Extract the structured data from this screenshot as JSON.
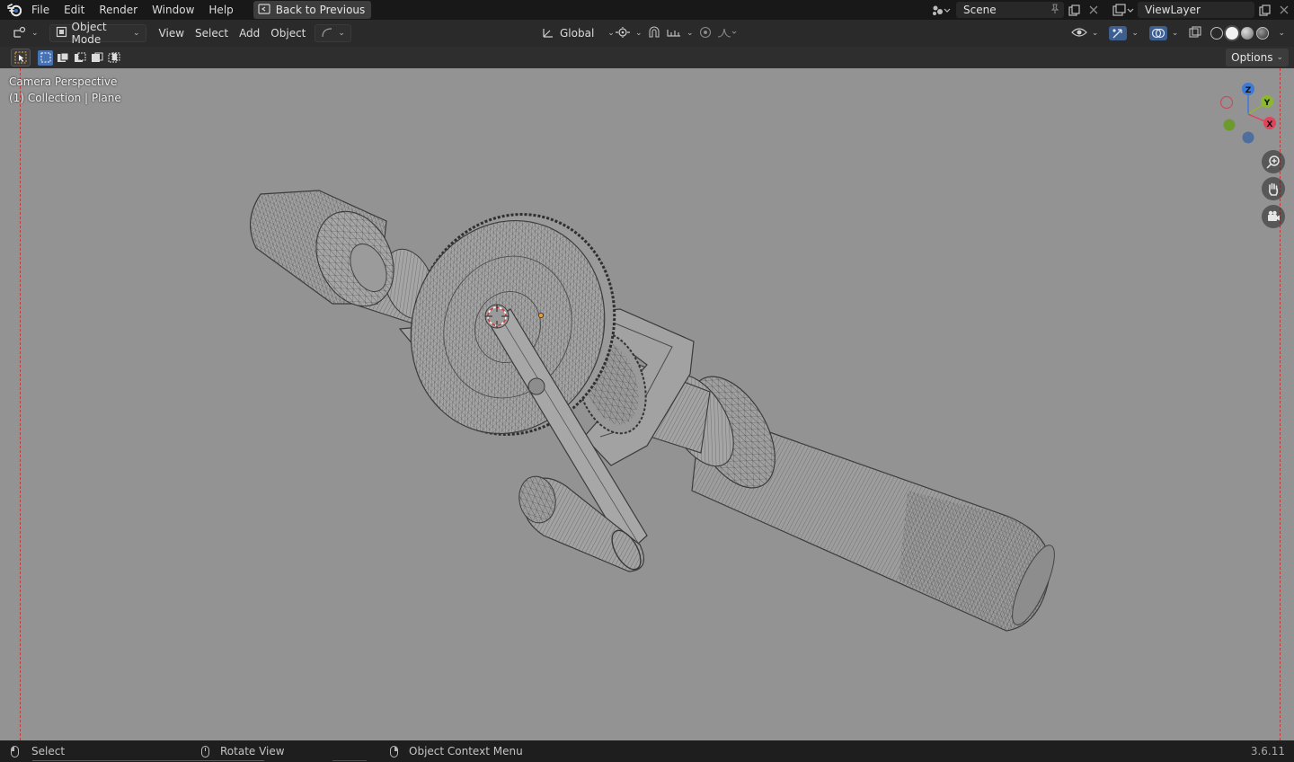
{
  "topbar": {
    "menus": [
      "File",
      "Edit",
      "Render",
      "Window",
      "Help"
    ],
    "back_button": "Back to Previous",
    "scene_name": "Scene",
    "view_layer": "ViewLayer"
  },
  "header": {
    "mode": "Object Mode",
    "menus": [
      "View",
      "Select",
      "Add",
      "Object"
    ],
    "transform_orientation": "Global"
  },
  "toolbar": {
    "options_label": "Options"
  },
  "viewport": {
    "camera_label": "Camera Perspective",
    "object_label": "(1) Collection | Plane",
    "gizmo_axes": [
      "Z",
      "Y",
      "X"
    ],
    "background_color": "#939393",
    "mesh_color": "#9b9b9b",
    "wire_color": "#3e3e3e"
  },
  "statusbar": {
    "select": "Select",
    "rotate": "Rotate View",
    "context": "Object Context Menu",
    "version": "3.6.11"
  },
  "colors": {
    "accent": "#4772b3",
    "axis_x": "#e0445a",
    "axis_y": "#8cb830",
    "axis_z": "#3d7ad8"
  }
}
